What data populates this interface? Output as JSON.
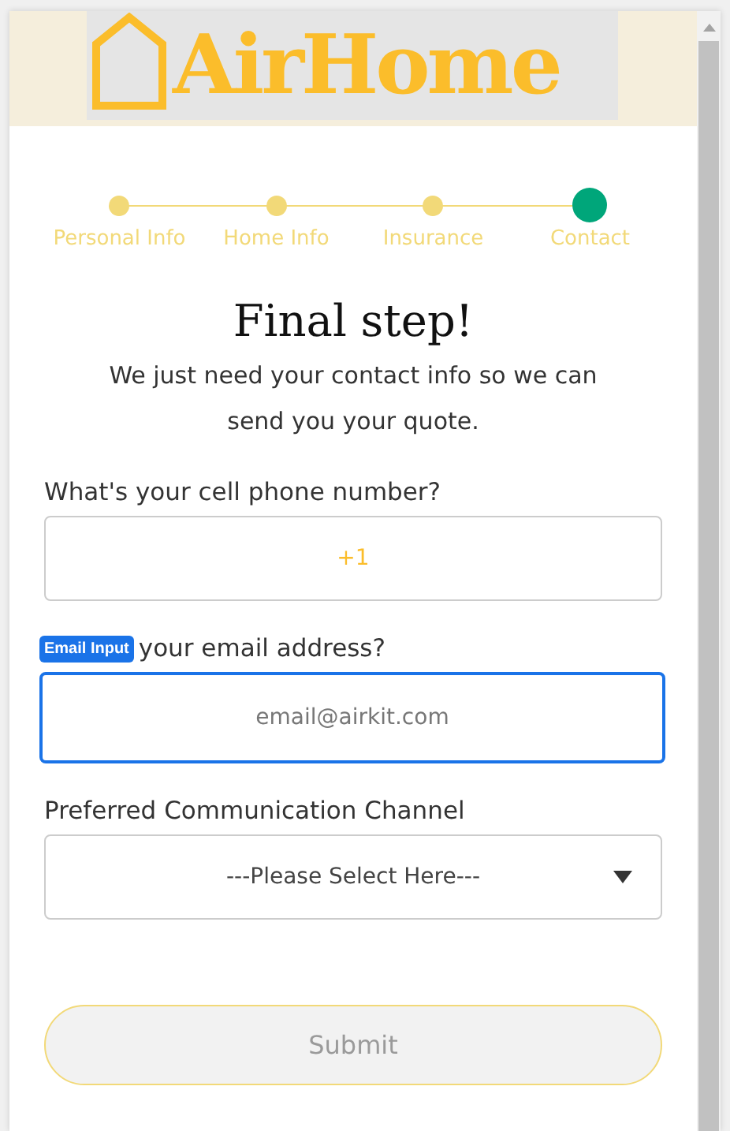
{
  "brand": {
    "name": "AirHome"
  },
  "steps": [
    {
      "label": "Personal Info",
      "selected": false
    },
    {
      "label": "Home Info",
      "selected": false
    },
    {
      "label": "Insurance",
      "selected": false
    },
    {
      "label": "Contact",
      "selected": true
    }
  ],
  "heading": "Final step!",
  "subtitle": "We just need your contact info so we can send you your quote.",
  "fields": [
    {
      "kind": "text",
      "label": "What's your cell phone number?",
      "value": "+1",
      "focused": false
    },
    {
      "kind": "text",
      "label": "your email address?",
      "badge": "Email Input",
      "placeholder": "email@airkit.com",
      "focused": true
    },
    {
      "kind": "select",
      "label": "Preferred Communication Channel",
      "value": "---Please Select Here---",
      "focused": false
    }
  ],
  "submit": {
    "label": "Submit",
    "disabled": true
  }
}
